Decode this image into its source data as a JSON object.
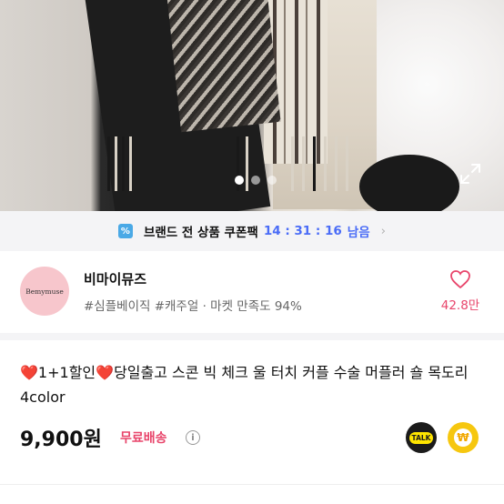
{
  "hero": {
    "image_alt": "",
    "dots_total": 3,
    "dots_active": 0
  },
  "coupon": {
    "icon": "ticket-percent-icon",
    "label": "브랜드 전 상품 쿠폰팩",
    "timer": "14 : 31 : 16",
    "timer_suffix": "남음",
    "chevron": "›"
  },
  "store": {
    "logo_text": "Bemymuse",
    "name": "비마이뮤즈",
    "tags": "#심플베이직 #캐주얼 · 마켓 만족도 94%",
    "likes": "42.8만"
  },
  "product": {
    "title_pre": "❤️",
    "title_a": "1+1할인",
    "title_mid": "❤️",
    "title_b": "당일출고 스콘 빅 체크 울 터치 커플 수술 머플러 숄 목도리 4color",
    "price": "9,900원",
    "shipping": "무료배송",
    "info_glyph": "i",
    "talk_label": "TALK",
    "won_glyph": "₩"
  },
  "colors": {
    "accent_pink": "#e8456b",
    "timer_blue": "#4a6cf7",
    "talk_yellow": "#fee500",
    "pay_yellow": "#f6c70f"
  }
}
